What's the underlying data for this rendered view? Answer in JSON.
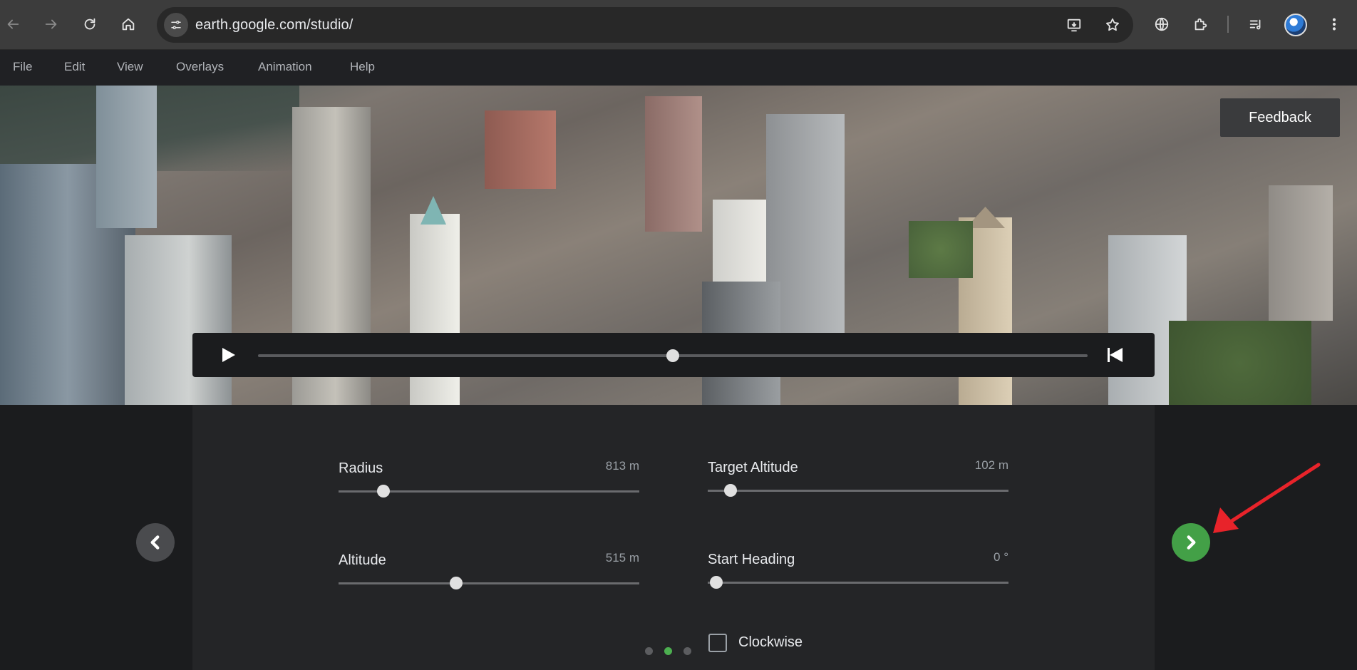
{
  "browser": {
    "url": "earth.google.com/studio/",
    "icons": {
      "back": "back-arrow-icon",
      "forward": "forward-arrow-icon",
      "reload": "reload-icon",
      "home": "home-icon",
      "site_info": "tune-icon",
      "install": "install-app-icon",
      "bookmark": "star-icon",
      "translate": "globe-icon",
      "extensions": "puzzle-icon",
      "media": "media-queue-icon",
      "menu": "kebab-menu-icon"
    }
  },
  "menubar": {
    "items": [
      "File",
      "Edit",
      "View",
      "Overlays",
      "Animation",
      "Help"
    ]
  },
  "viewport": {
    "feedback_label": "Feedback",
    "playback_progress": 0.5
  },
  "settings": {
    "radius": {
      "label": "Radius",
      "value": "813 m",
      "fraction": 0.15
    },
    "target_altitude": {
      "label": "Target Altitude",
      "value": "102 m",
      "fraction": 0.077
    },
    "altitude": {
      "label": "Altitude",
      "value": "515 m",
      "fraction": 0.39
    },
    "start_heading": {
      "label": "Start Heading",
      "value": "0 °",
      "fraction": 0.028
    },
    "clockwise": {
      "label": "Clockwise",
      "checked": false
    }
  },
  "pager": {
    "pages": 3,
    "current": 2
  },
  "colors": {
    "accent_green": "#43a047",
    "active_dot": "#4caf50",
    "annotation_red": "#e8232a"
  }
}
